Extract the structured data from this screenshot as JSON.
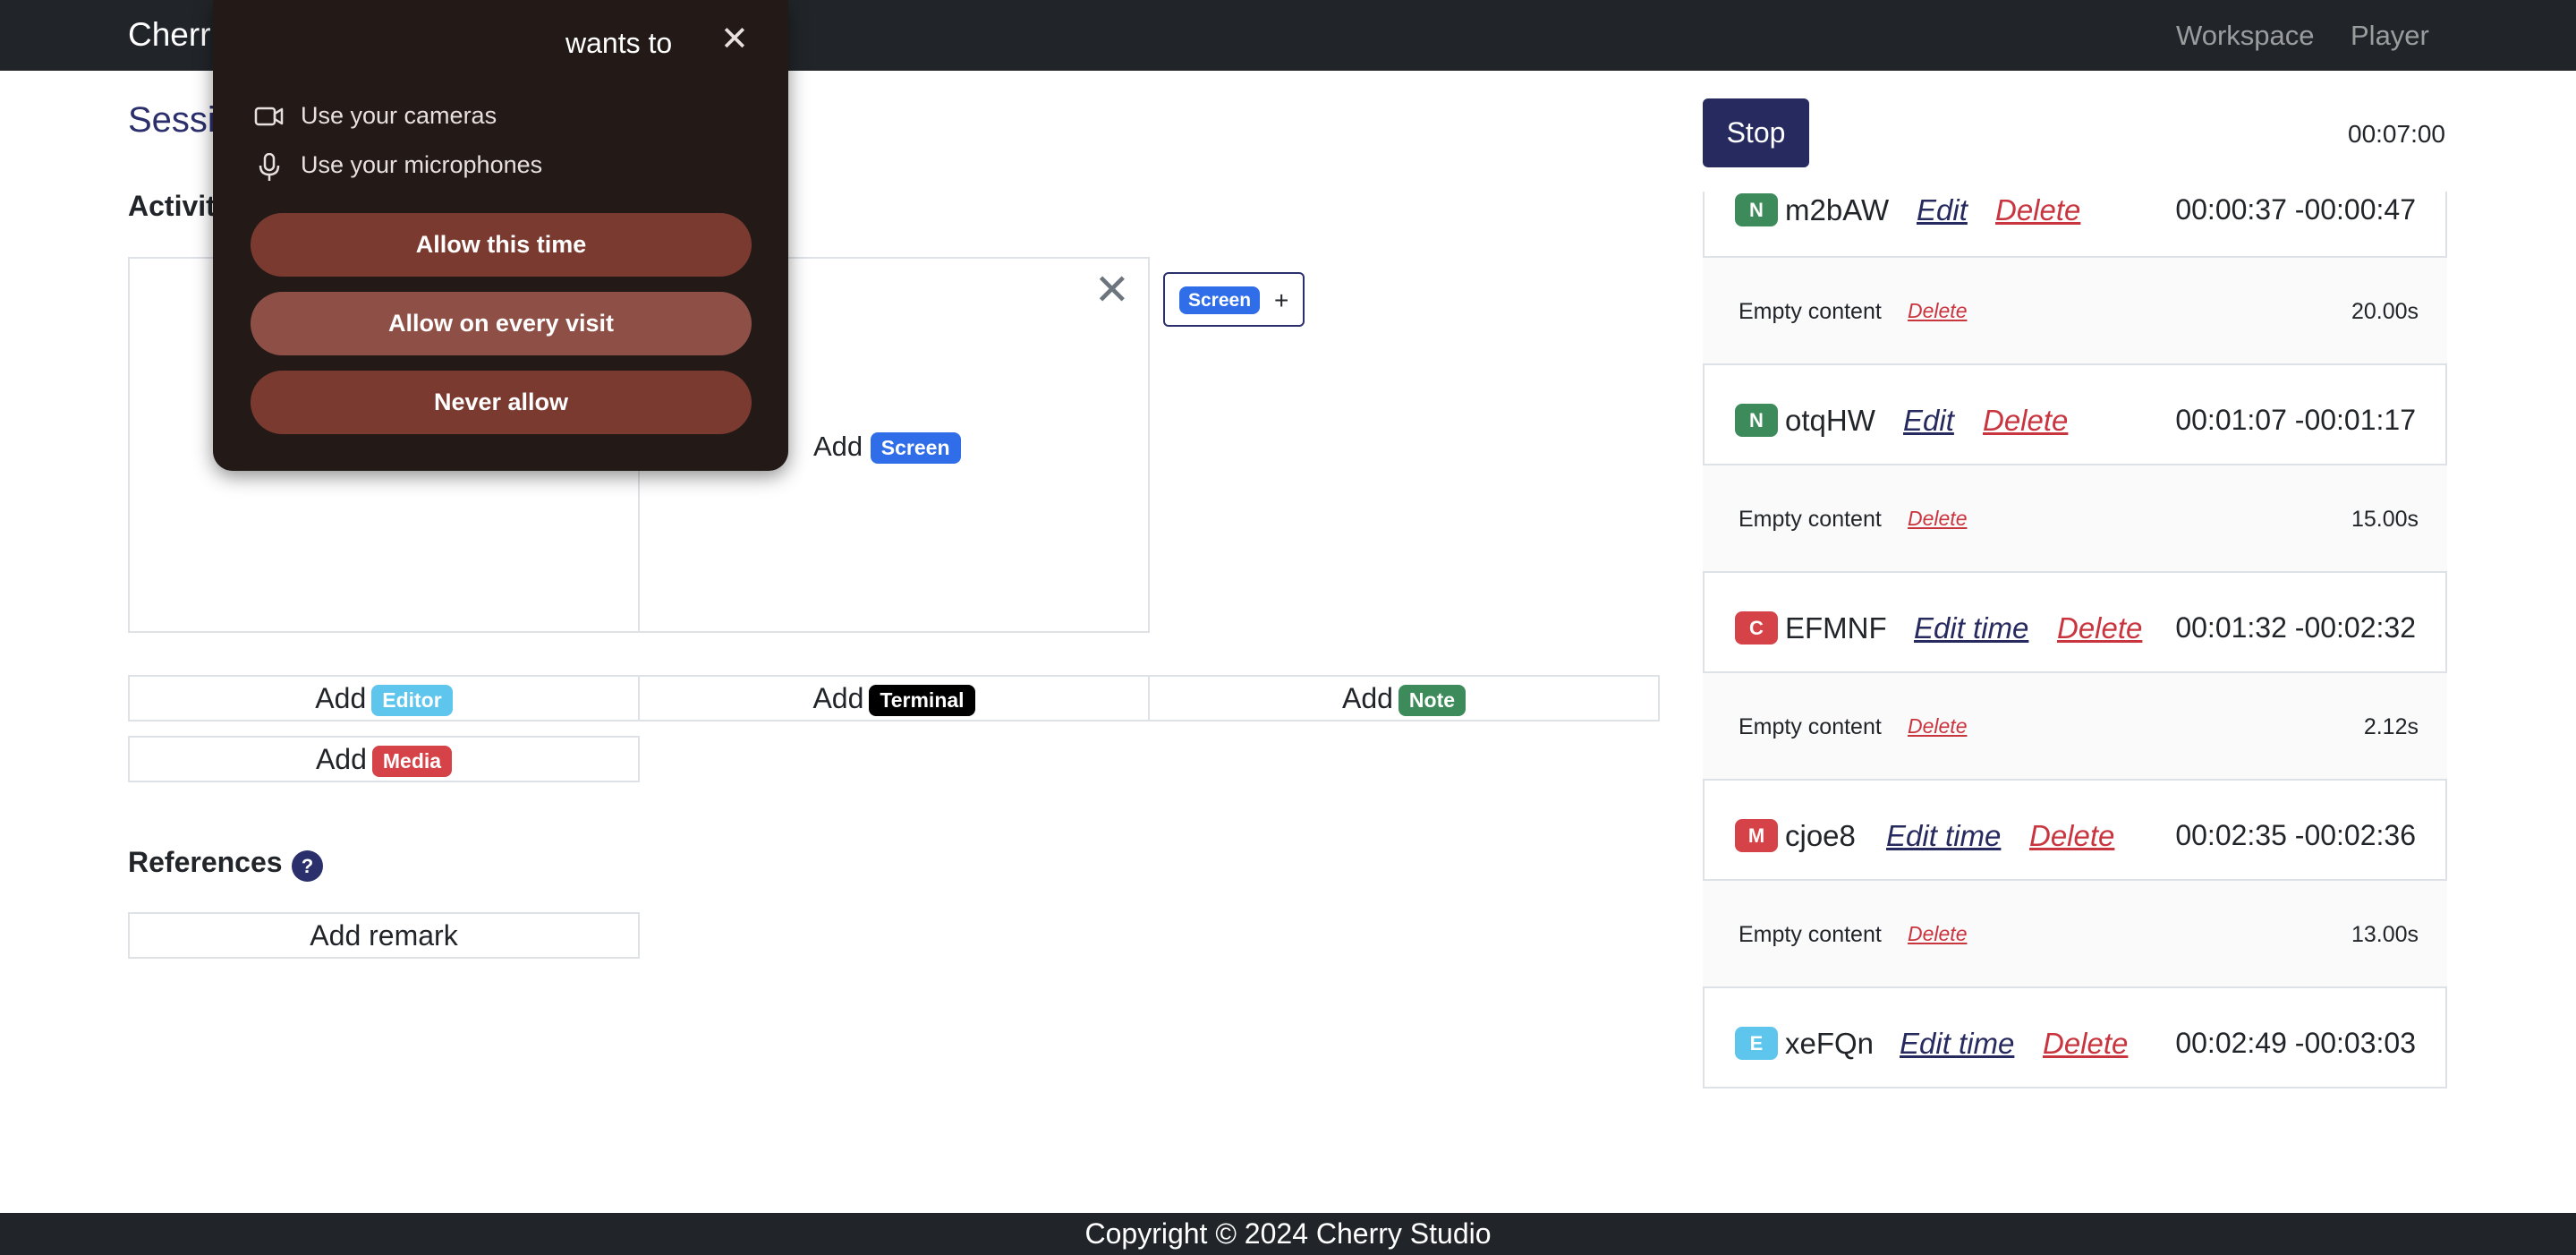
{
  "navbar": {
    "brand": "Cherr",
    "links": [
      "Workspace",
      "Player"
    ]
  },
  "page": {
    "session_title": "Sessi",
    "activities_title": "Activit",
    "references_title": "References",
    "help_glyph": "?"
  },
  "panels": {
    "close_glyph": "✕",
    "add_text": "Add",
    "screen_badge": "Screen"
  },
  "tab_chip": {
    "badge": "Screen",
    "plus": "+"
  },
  "add_buttons": [
    {
      "prefix": "Add",
      "badge": "Editor"
    },
    {
      "prefix": "Add",
      "badge": "Terminal"
    },
    {
      "prefix": "Add",
      "badge": "Note"
    },
    {
      "prefix": "Add",
      "badge": "Media"
    }
  ],
  "add_remark_label": "Add remark",
  "recorder": {
    "stop_label": "Stop",
    "timer": "00:07:00"
  },
  "timeline": {
    "segments": [
      {
        "type": "N",
        "name": "m2bAW",
        "edit": "Edit",
        "delete": "Delete",
        "range": "00:00:37 -00:00:47"
      },
      {
        "type": "N",
        "name": "otqHW",
        "edit": "Edit",
        "delete": "Delete",
        "range": "00:01:07 -00:01:17"
      },
      {
        "type": "C",
        "name": "EFMNF",
        "edit": "Edit time",
        "delete": "Delete",
        "range": "00:01:32 -00:02:32"
      },
      {
        "type": "M",
        "name": "cjoe8",
        "edit": "Edit time",
        "delete": "Delete",
        "range": "00:02:35 -00:02:36"
      },
      {
        "type": "E",
        "name": "xeFQn",
        "edit": "Edit time",
        "delete": "Delete",
        "range": "00:02:49 -00:03:03"
      }
    ],
    "gaps": [
      {
        "text": "Empty content",
        "delete": "Delete",
        "duration": "20.00s"
      },
      {
        "text": "Empty content",
        "delete": "Delete",
        "duration": "15.00s"
      },
      {
        "text": "Empty content",
        "delete": "Delete",
        "duration": "2.12s"
      },
      {
        "text": "Empty content",
        "delete": "Delete",
        "duration": "13.00s"
      }
    ]
  },
  "footer": {
    "text": "Copyright © 2024 Cherry Studio"
  },
  "permission_popup": {
    "title": "wants to",
    "close_glyph": "✕",
    "permissions": [
      "Use your cameras",
      "Use your microphones"
    ],
    "buttons": [
      "Allow this time",
      "Allow on every visit",
      "Never allow"
    ]
  },
  "colors": {
    "navbar": "#212529",
    "primary": "#262a5e",
    "danger": "#c9353f",
    "screen": "#2f6ee8",
    "editor": "#5ec5ed",
    "terminal": "#000000",
    "note": "#3d8b5a",
    "media": "#d54348",
    "popup_bg": "#231a18",
    "popup_button": "#7a3a30"
  }
}
